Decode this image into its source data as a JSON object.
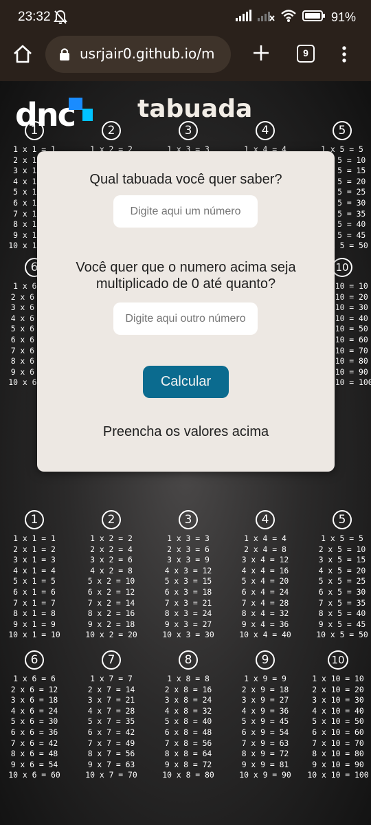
{
  "status_bar": {
    "time": "23:32",
    "battery": "91%",
    "icons": [
      "mute-bell-icon",
      "signal-icon",
      "signal-noservice-icon",
      "wifi-icon",
      "battery-icon"
    ]
  },
  "browser": {
    "url": "usrjair0.github.io/m",
    "tab_count": "9"
  },
  "page": {
    "logo_text": "dnc",
    "title": "tabuada",
    "form": {
      "question_1": "Qual tabuada você quer saber?",
      "input_1_placeholder": "Digite aqui um número",
      "question_2_line1": "Você quer que o numero acima seja",
      "question_2_line2": "multiplicado de 0 até quanto?",
      "input_2_placeholder": "Digite aqui outro número",
      "button_label": "Calcular",
      "message": "Preencha os valores acima"
    },
    "tables": {
      "t1": {
        "label": "1",
        "rows": [
          "1 x 1 = 1",
          "2 x 1 = 2",
          "3 x 1 = 3",
          "4 x 1 = 4",
          "5 x 1 = 5",
          "6 x 1 = 6",
          "7 x 1 = 7",
          "8 x 1 = 8",
          "9 x 1 = 9",
          "10 x 1 = 10"
        ]
      },
      "t2": {
        "label": "2",
        "rows": [
          "1 x 2 = 2",
          "2 x 2 = 4",
          "3 x 2 = 6",
          "4 x 2 = 8",
          "5 x 2 = 10",
          "6 x 2 = 12",
          "7 x 2 = 14",
          "8 x 2 = 16",
          "9 x 2 = 18",
          "10 x 2 = 20"
        ]
      },
      "t3": {
        "label": "3",
        "rows": [
          "1 x 3 = 3",
          "2 x 3 = 6",
          "3 x 3 = 9",
          "4 x 3 = 12",
          "5 x 3 = 15",
          "6 x 3 = 18",
          "7 x 3 = 21",
          "8 x 3 = 24",
          "9 x 3 = 27",
          "10 x 3 = 30"
        ]
      },
      "t4": {
        "label": "4",
        "rows": [
          "1 x 4 = 4",
          "2 x 4 = 8",
          "3 x 4 = 12",
          "4 x 4 = 16",
          "5 x 4 = 20",
          "6 x 4 = 24",
          "7 x 4 = 28",
          "8 x 4 = 32",
          "9 x 4 = 36",
          "10 x 4 = 40"
        ]
      },
      "t5": {
        "label": "5",
        "rows": [
          "1 x 5 = 5",
          "2 x 5 = 10",
          "3 x 5 = 15",
          "4 x 5 = 20",
          "5 x 5 = 25",
          "6 x 5 = 30",
          "7 x 5 = 35",
          "8 x 5 = 40",
          "9 x 5 = 45",
          "10 x 5 = 50"
        ]
      },
      "t6": {
        "label": "6",
        "rows": [
          "1 x 6 = 6",
          "2 x 6 = 12",
          "3 x 6 = 18",
          "4 x 6 = 24",
          "5 x 6 = 30",
          "6 x 6 = 36",
          "7 x 6 = 42",
          "8 x 6 = 48",
          "9 x 6 = 54",
          "10 x 6 = 60"
        ]
      },
      "t7": {
        "label": "7",
        "rows": [
          "1 x 7 = 7",
          "2 x 7 = 14",
          "3 x 7 = 21",
          "4 x 7 = 28",
          "5 x 7 = 35",
          "6 x 7 = 42",
          "7 x 7 = 49",
          "8 x 7 = 56",
          "9 x 7 = 63",
          "10 x 7 = 70"
        ]
      },
      "t8": {
        "label": "8",
        "rows": [
          "1 x 8 = 8",
          "2 x 8 = 16",
          "3 x 8 = 24",
          "4 x 8 = 32",
          "5 x 8 = 40",
          "6 x 8 = 48",
          "7 x 8 = 56",
          "8 x 8 = 64",
          "9 x 8 = 72",
          "10 x 8 = 80"
        ]
      },
      "t9": {
        "label": "9",
        "rows": [
          "1 x 9 = 9",
          "2 x 9 = 18",
          "3 x 9 = 27",
          "4 x 9 = 36",
          "5 x 9 = 45",
          "6 x 9 = 54",
          "7 x 9 = 63",
          "8 x 9 = 72",
          "9 x 9 = 81",
          "10 x 9 = 90"
        ]
      },
      "t10": {
        "label": "10",
        "rows": [
          "1 x 10 = 10",
          "2 x 10 = 20",
          "3 x 10 = 30",
          "4 x 10 = 40",
          "5 x 10 = 50",
          "6 x 10 = 60",
          "7 x 10 = 70",
          "8 x 10 = 80",
          "9 x 10 = 90",
          "10 x 10 = 100"
        ]
      }
    }
  },
  "colors": {
    "button": "#0b6b8f",
    "modal_bg": "#ede8e3",
    "logo_accent": "#1a8cff",
    "browser_bar": "#2a211b"
  }
}
